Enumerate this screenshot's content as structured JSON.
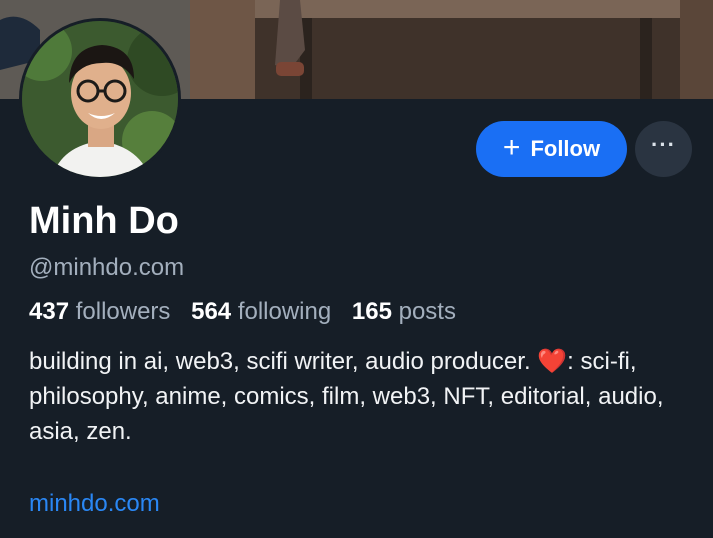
{
  "profile": {
    "display_name": "Minh Do",
    "handle": "@minhdo.com",
    "stats": {
      "followers_count": "437",
      "followers_label": "followers",
      "following_count": "564",
      "following_label": "following",
      "posts_count": "165",
      "posts_label": "posts"
    },
    "bio": {
      "text_before_heart": "building in ai, web3, scifi writer, audio producer. ",
      "heart": "❤️",
      "text_after_heart": ": sci-fi, philosophy, anime, comics, film, web3, NFT, editorial, audio, asia, zen."
    },
    "website": "minhdo.com"
  },
  "actions": {
    "follow_plus": "+",
    "follow_label": "Follow",
    "more_label": "···"
  },
  "icons": {
    "banner": "banner-image",
    "avatar": "avatar-photo",
    "more": "more-options-icon",
    "follow": "plus-icon"
  },
  "colors": {
    "background": "#161e27",
    "accent": "#1a6ff4",
    "link": "#2a87f4",
    "muted": "#a3afbd"
  }
}
